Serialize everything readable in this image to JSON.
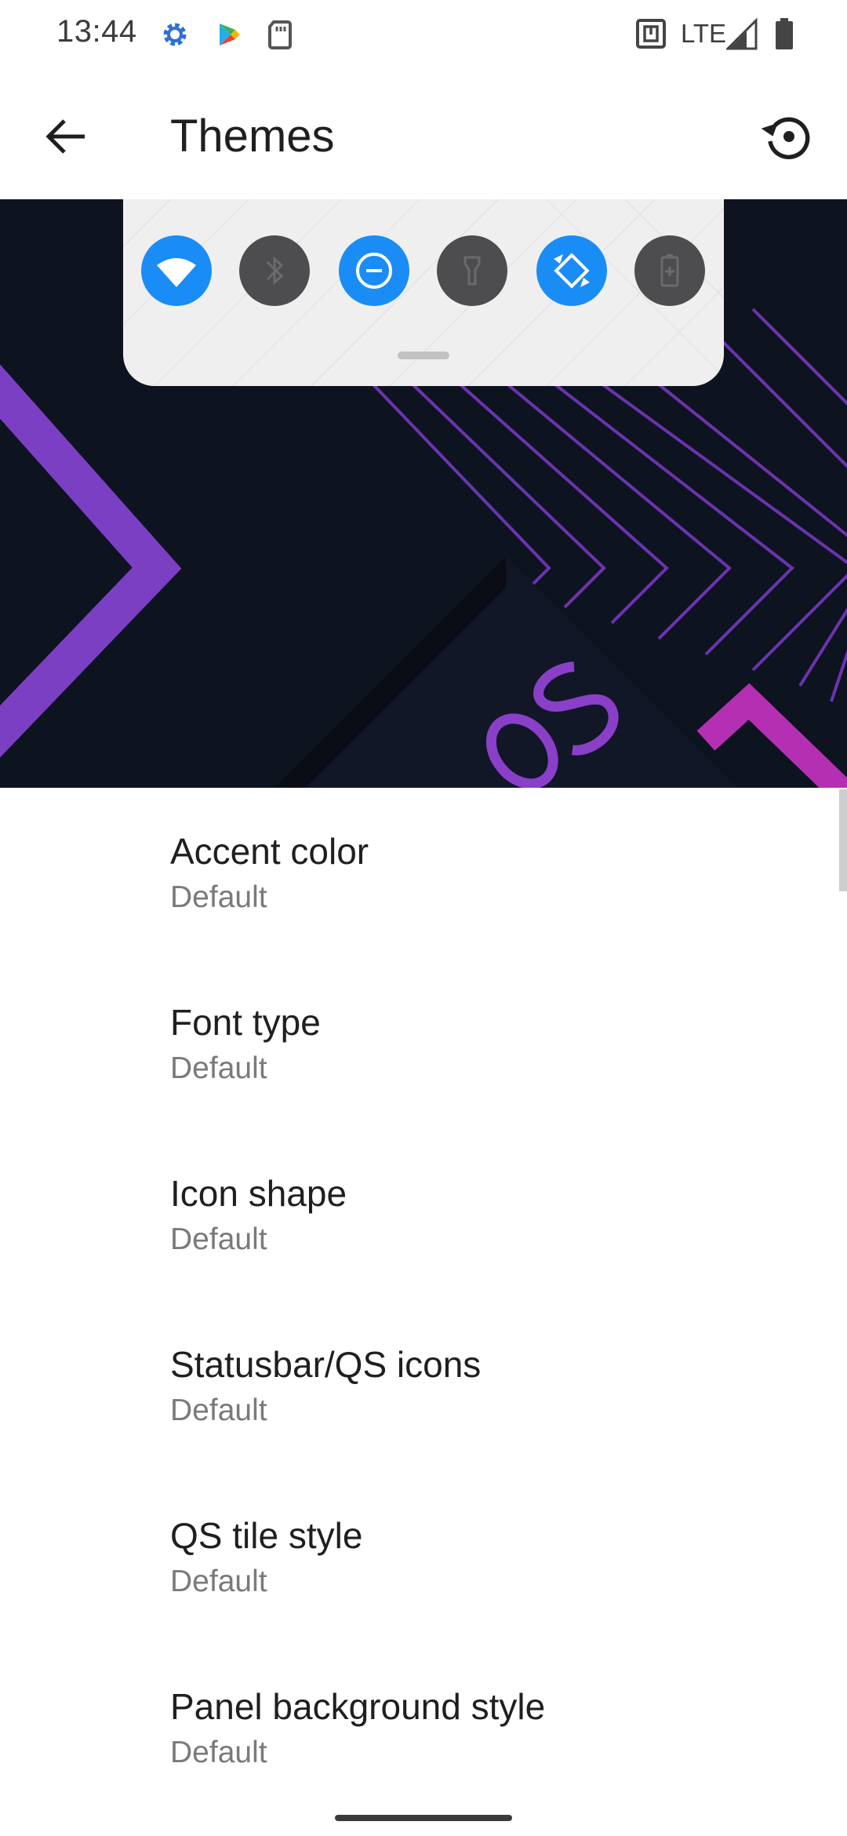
{
  "status_bar": {
    "time": "13:44",
    "network": "LTE",
    "icons": [
      "settings-gear-icon",
      "play-store-icon",
      "sd-card-icon",
      "nfc-icon",
      "signal-icon",
      "battery-icon"
    ]
  },
  "app_bar": {
    "title": "Themes",
    "back_icon": "arrow-back-icon",
    "restore_icon": "restore-icon"
  },
  "preview": {
    "qs_tiles": [
      {
        "name": "wifi",
        "state": "on",
        "icon": "wifi-icon"
      },
      {
        "name": "bluetooth",
        "state": "off",
        "icon": "bluetooth-icon"
      },
      {
        "name": "do-not-disturb",
        "state": "on",
        "icon": "dnd-icon"
      },
      {
        "name": "flashlight",
        "state": "off",
        "icon": "flashlight-icon"
      },
      {
        "name": "auto-rotate",
        "state": "on",
        "icon": "auto-rotate-icon"
      },
      {
        "name": "battery-saver",
        "state": "off",
        "icon": "battery-saver-icon"
      }
    ],
    "wallpaper_text": "OS",
    "colors": {
      "background": "#0e1320",
      "accent_purple": "#7b3fc4",
      "accent_magenta": "#b52fb3",
      "tile_on": "#1a8cf5",
      "tile_off": "#4d4d4f"
    }
  },
  "settings": [
    {
      "title": "Accent color",
      "summary": "Default"
    },
    {
      "title": "Font type",
      "summary": "Default"
    },
    {
      "title": "Icon shape",
      "summary": "Default"
    },
    {
      "title": "Statusbar/QS icons",
      "summary": "Default"
    },
    {
      "title": "QS tile style",
      "summary": "Default"
    },
    {
      "title": "Panel background style",
      "summary": "Default"
    }
  ]
}
